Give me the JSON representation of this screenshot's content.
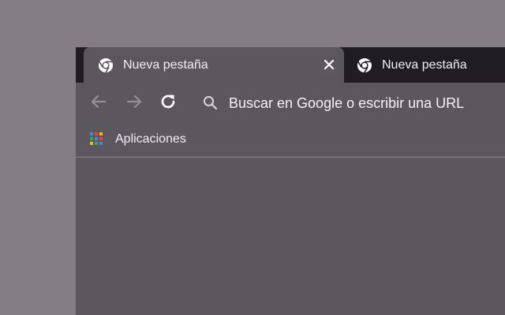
{
  "tabs": [
    {
      "title": "Nueva pestaña",
      "active": true,
      "icon": "chrome-icon"
    },
    {
      "title": "Nueva pestaña",
      "active": false,
      "icon": "chrome-icon"
    }
  ],
  "toolbar": {
    "back_icon": "back-arrow-icon",
    "forward_icon": "forward-arrow-icon",
    "reload_icon": "reload-icon"
  },
  "omnibox": {
    "placeholder": "Buscar en Google o escribir una URL",
    "value": ""
  },
  "bookmarks": {
    "items": [
      {
        "label": "Aplicaciones",
        "icon": "apps-grid-icon"
      }
    ]
  },
  "colors": {
    "desktop": "#847d85",
    "tabstrip": "#1f1d21",
    "frame": "#5c575e",
    "text": "#f1eff2",
    "apps_grid": [
      "#4285f4",
      "#ea4335",
      "#fbbc05",
      "#34a853"
    ]
  }
}
